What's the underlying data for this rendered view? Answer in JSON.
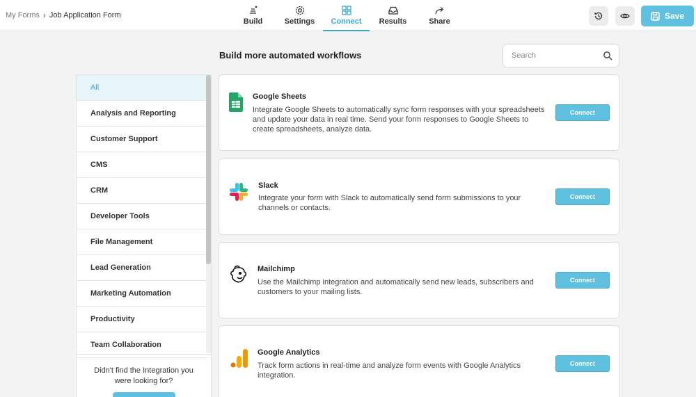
{
  "breadcrumb": {
    "parent": "My Forms",
    "separator": "›",
    "current": "Job Application Form"
  },
  "nav": [
    {
      "label": "Build",
      "icon": "build-icon"
    },
    {
      "label": "Settings",
      "icon": "gear-icon"
    },
    {
      "label": "Connect",
      "icon": "connect-icon",
      "active": true
    },
    {
      "label": "Results",
      "icon": "inbox-icon"
    },
    {
      "label": "Share",
      "icon": "share-icon"
    }
  ],
  "toolbar": {
    "save_label": "Save",
    "history_icon": "history-icon",
    "preview_icon": "eye-icon"
  },
  "main": {
    "heading": "Build more automated workflows",
    "search": {
      "placeholder": "Search",
      "value": ""
    }
  },
  "sidebar": {
    "categories": [
      {
        "label": "All",
        "active": true
      },
      {
        "label": "Analysis and Reporting"
      },
      {
        "label": "Customer Support"
      },
      {
        "label": "CMS"
      },
      {
        "label": "CRM"
      },
      {
        "label": "Developer Tools"
      },
      {
        "label": "File Management"
      },
      {
        "label": "Lead Generation"
      },
      {
        "label": "Marketing Automation"
      },
      {
        "label": "Productivity"
      },
      {
        "label": "Team Collaboration"
      }
    ],
    "help_text": "Didn't find the Integration you were looking for?"
  },
  "integrations": [
    {
      "name": "Google Sheets",
      "description": "Integrate Google Sheets to automatically sync form responses with your spreadsheets and update your data in real time. Send your form responses to Google Sheets to create spreadsheets, analyze data.",
      "button": "Connect",
      "icon": "google-sheets-icon"
    },
    {
      "name": "Slack",
      "description": "Integrate your form with Slack to automatically send form submissions to your channels or contacts.",
      "button": "Connect",
      "icon": "slack-icon"
    },
    {
      "name": "Mailchimp",
      "description": "Use the Mailchimp integration and automatically send new leads, subscribers and customers to your mailing lists.",
      "button": "Connect",
      "icon": "mailchimp-icon"
    },
    {
      "name": "Google Analytics",
      "description": "Track form actions in real-time and analyze form events with Google Analytics integration.",
      "button": "Connect",
      "icon": "google-analytics-icon"
    }
  ],
  "colors": {
    "accent": "#5fc0e0",
    "active_tab": "#3ba6cf",
    "sidebar_active_bg": "#e7f5fb"
  }
}
